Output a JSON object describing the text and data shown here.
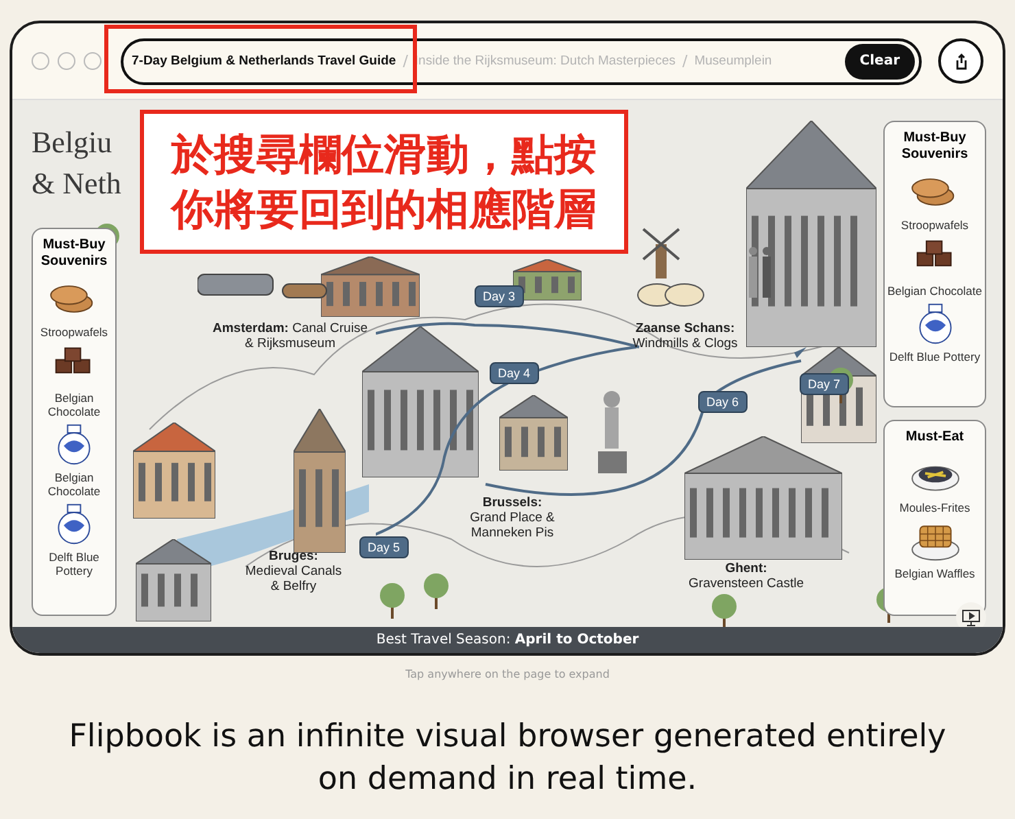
{
  "breadcrumbs": [
    {
      "label": "7-Day Belgium & Netherlands Travel Guide",
      "selected": true
    },
    {
      "label": "Inside the Rijksmuseum: Dutch Masterpieces",
      "selected": false
    },
    {
      "label": "Museumplein",
      "selected": false
    }
  ],
  "separators": [
    "/",
    "/"
  ],
  "clear_button": "Clear",
  "map": {
    "title_lines": [
      "Belgiu",
      "& Neth"
    ],
    "sidebars": [
      {
        "title": "Must-Buy Souvenirs",
        "items": [
          {
            "label": "Stroopwafels",
            "kind": "stroopwafel"
          },
          {
            "label": "Belgian Chocolate",
            "kind": "chocolate"
          },
          {
            "label": "Belgian Chocolate",
            "kind": "vase"
          },
          {
            "label": "Delft Blue Pottery",
            "kind": "vase"
          }
        ]
      },
      {
        "title": "Must-Buy Souvenirs",
        "items": [
          {
            "label": "Stroopwafels",
            "kind": "stroopwafel"
          },
          {
            "label": "Belgian Chocolate",
            "kind": "chocolate"
          },
          {
            "label": "Delft Blue Pottery",
            "kind": "vase"
          }
        ]
      },
      {
        "title": "Must-Eat",
        "items": [
          {
            "label": "Moules-Frites",
            "kind": "mussels"
          },
          {
            "label": "Belgian Waffles",
            "kind": "waffle"
          }
        ]
      }
    ],
    "stops": [
      {
        "lines": [
          "**Amsterdam:** Canal Cruise",
          "& Rijksmuseum"
        ]
      },
      {
        "lines": [
          "**Zaanse Schans:**",
          "Windmills & Clogs"
        ]
      },
      {
        "lines": [
          "**Brussels:**",
          "Grand Place &",
          "Manneken Pis"
        ]
      },
      {
        "lines": [
          "**Bruges:**",
          "Medieval Canals",
          "& Belfry"
        ]
      },
      {
        "lines": [
          "**Ghent:**",
          "Gravensteen Castle"
        ]
      }
    ],
    "day_tags": [
      "Day 3",
      "Day 4",
      "Day 5",
      "Day 6",
      "Day 7"
    ],
    "footer": "Best Travel Season: **April to October**"
  },
  "hint": "Tap anywhere on the page to expand",
  "callout": {
    "lines": [
      "於搜尋欄位滑動，點按",
      "你將要回到的相應階層"
    ]
  },
  "caption": "Flipbook is an infinite visual browser generated entirely on demand in real time."
}
